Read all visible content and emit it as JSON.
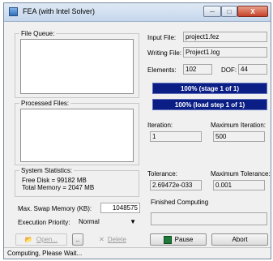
{
  "window": {
    "title": "FEA (with Intel Solver)",
    "minimize": "─",
    "maximize": "□",
    "close": "X"
  },
  "file_queue": {
    "label": "File Queue:"
  },
  "processed_files": {
    "label": "Processed Files:"
  },
  "system_statistics": {
    "label": "System Statistics:",
    "free_disk": "Free Disk = 99182 MB",
    "total_memory": "Total Memory = 2047 MB"
  },
  "settings": {
    "max_swap_label": "Max. Swap Memory (KB):",
    "max_swap_value": "1048575",
    "priority_label": "Execution Priority:",
    "priority_value": "Normal"
  },
  "buttons": {
    "open": "Open...",
    "small": "..",
    "delete": "Delete",
    "pause": "Pause",
    "abort": "Abort"
  },
  "info": {
    "input_file_label": "Input File:",
    "input_file_value": "project1.fez",
    "writing_file_label": "Writing File:",
    "writing_file_value": "Project1.log",
    "elements_label": "Elements:",
    "elements_value": "102",
    "dof_label": "DOF:",
    "dof_value": "44"
  },
  "progress": {
    "stage_text": "100%  (stage 1 of 1)",
    "load_text": "100%  (load step 1 of 1)",
    "stage_fraction": 1.0,
    "load_fraction": 1.0
  },
  "iteration": {
    "iteration_label": "Iteration:",
    "iteration_value": "1",
    "max_iteration_label": "Maximum Iteration:",
    "max_iteration_value": "500"
  },
  "tolerance": {
    "tolerance_label": "Tolerance:",
    "tolerance_value": "2.69472e-033",
    "max_tolerance_label": "Maximum Tolerance:",
    "max_tolerance_value": "0.001"
  },
  "finished": {
    "label": "Finished Computing"
  },
  "status": {
    "text": "Computing, Please Wait..."
  }
}
